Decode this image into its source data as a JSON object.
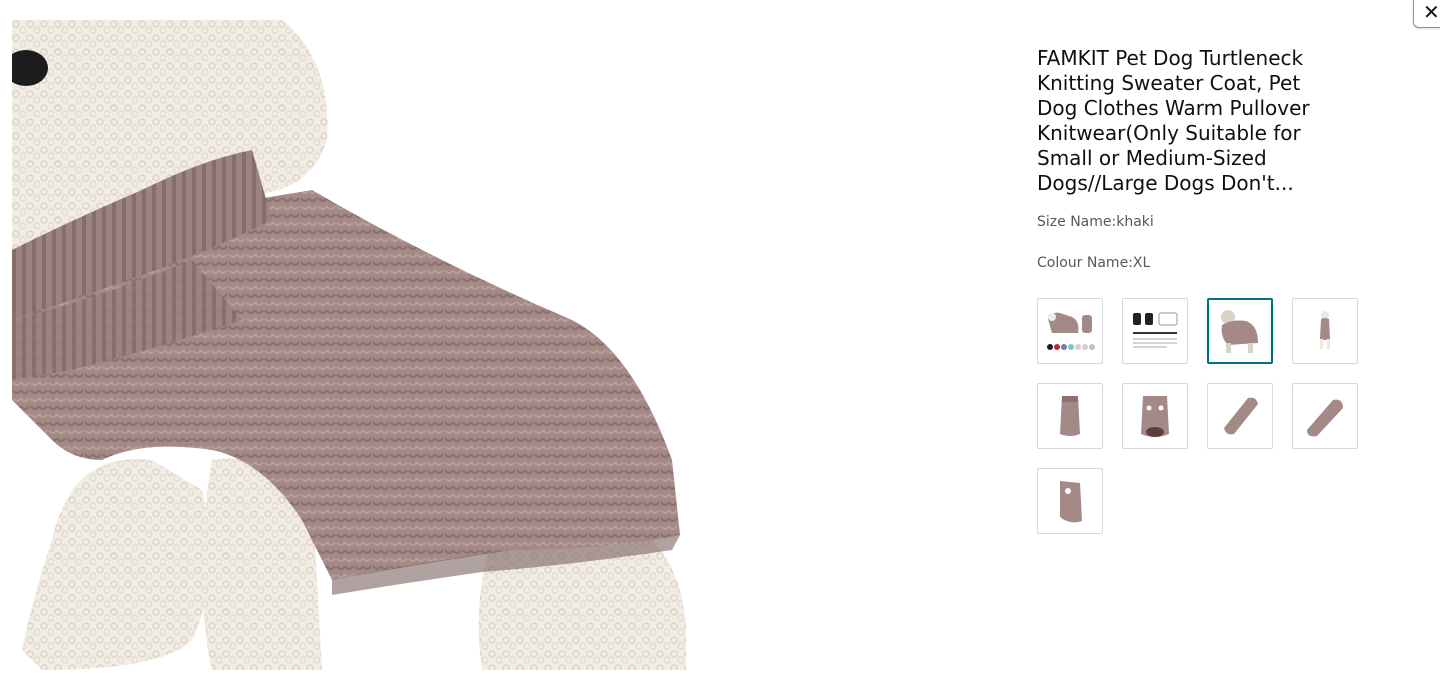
{
  "dialog": {
    "close_icon": "close-icon",
    "close_glyph": "✕"
  },
  "product": {
    "title": "FAMKIT Pet Dog Turtleneck Knitting Sweater Coat, Pet Dog Clothes Warm Pullover Knitwear(Only Suitable for Small or Medium-Sized Dogs//Large Dogs Don't...",
    "size_line": "Size Name:khaki",
    "colour_line": "Colour Name:XL"
  },
  "main_image": {
    "subject": "dog-wearing-knit-turtleneck-sweater",
    "sweater_color": "#a38a86",
    "fur_color": "#f1ece4"
  },
  "thumbnails": [
    {
      "name": "dog-with-sweater-and-color-swatches",
      "selected": false
    },
    {
      "name": "size-chart-diagram",
      "selected": false
    },
    {
      "name": "dog-in-sweater-side-view",
      "selected": true
    },
    {
      "name": "small-dog-in-sweater-standing",
      "selected": false
    },
    {
      "name": "sweater-back-view",
      "selected": false
    },
    {
      "name": "sweater-front-view-with-opening",
      "selected": false
    },
    {
      "name": "sweater-folded-diagonal",
      "selected": false
    },
    {
      "name": "sweater-folded-diagonal-2",
      "selected": false
    },
    {
      "name": "sweater-side-panel",
      "selected": false
    }
  ],
  "colors": {
    "accent_selected": "#007185",
    "thumb_border": "#d5d9d9",
    "secondary_text": "#565959"
  }
}
